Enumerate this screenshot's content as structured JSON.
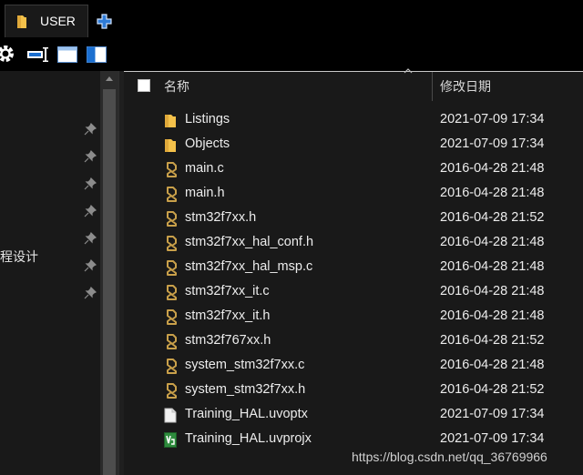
{
  "tab": {
    "label": "USER"
  },
  "sidebar": {
    "quick_access_partial_label": "程设计",
    "pins": 7
  },
  "columns": {
    "name": "名称",
    "date_modified": "修改日期"
  },
  "files": [
    {
      "name": "Listings",
      "date": "2021-07-09 17:34",
      "icon": "folder-icon"
    },
    {
      "name": "Objects",
      "date": "2021-07-09 17:34",
      "icon": "folder-icon"
    },
    {
      "name": "main.c",
      "date": "2016-04-28 21:48",
      "icon": "source-file-icon"
    },
    {
      "name": "main.h",
      "date": "2016-04-28 21:48",
      "icon": "source-file-icon"
    },
    {
      "name": "stm32f7xx.h",
      "date": "2016-04-28 21:52",
      "icon": "source-file-icon"
    },
    {
      "name": "stm32f7xx_hal_conf.h",
      "date": "2016-04-28 21:48",
      "icon": "source-file-icon"
    },
    {
      "name": "stm32f7xx_hal_msp.c",
      "date": "2016-04-28 21:48",
      "icon": "source-file-icon"
    },
    {
      "name": "stm32f7xx_it.c",
      "date": "2016-04-28 21:48",
      "icon": "source-file-icon"
    },
    {
      "name": "stm32f7xx_it.h",
      "date": "2016-04-28 21:48",
      "icon": "source-file-icon"
    },
    {
      "name": "stm32f767xx.h",
      "date": "2016-04-28 21:52",
      "icon": "source-file-icon"
    },
    {
      "name": "system_stm32f7xx.c",
      "date": "2016-04-28 21:48",
      "icon": "source-file-icon"
    },
    {
      "name": "system_stm32f7xx.h",
      "date": "2016-04-28 21:52",
      "icon": "source-file-icon"
    },
    {
      "name": "Training_HAL.uvoptx",
      "date": "2021-07-09 17:34",
      "icon": "blank-document-icon"
    },
    {
      "name": "Training_HAL.uvprojx",
      "date": "2021-07-09 17:34",
      "icon": "keil-project-icon"
    }
  ],
  "watermark": "https://blog.csdn.net/qq_36769966",
  "colors": {
    "folder": "#f4c14a",
    "source_icon": "#c9a04a",
    "new_tab_plus": "#2f7cd8",
    "keil_green": "#2e8b3d"
  }
}
